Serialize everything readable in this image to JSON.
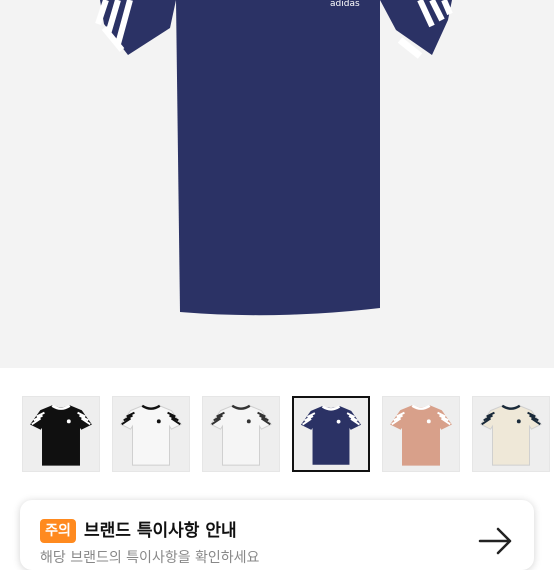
{
  "product": {
    "brand_mark": "adidas",
    "colors": {
      "navy": "#2b3265",
      "stripe": "#ffffff",
      "background": "#f3f3f3"
    }
  },
  "gallery": {
    "thumbnails": [
      {
        "color_name": "black",
        "shirt": "#101010",
        "trim": "#ffffff",
        "selected": false
      },
      {
        "color_name": "white",
        "shirt": "#f7f7f7",
        "trim": "#111111",
        "selected": false
      },
      {
        "color_name": "white",
        "shirt": "#f5f5f5",
        "trim": "#333333",
        "selected": false
      },
      {
        "color_name": "navy",
        "shirt": "#2b3265",
        "trim": "#ffffff",
        "selected": true
      },
      {
        "color_name": "peach",
        "shirt": "#d8a08a",
        "trim": "#ffffff",
        "selected": false
      },
      {
        "color_name": "cream",
        "shirt": "#efe8d8",
        "trim": "#1a2a3a",
        "selected": false
      }
    ]
  },
  "notice": {
    "badge": "주의",
    "title": "브랜드 특이사항 안내",
    "subtitle": "해당 브랜드의 특이사항을 확인하세요",
    "arrow_icon": "arrow-right-icon",
    "badge_color": "#ff8a1f"
  }
}
